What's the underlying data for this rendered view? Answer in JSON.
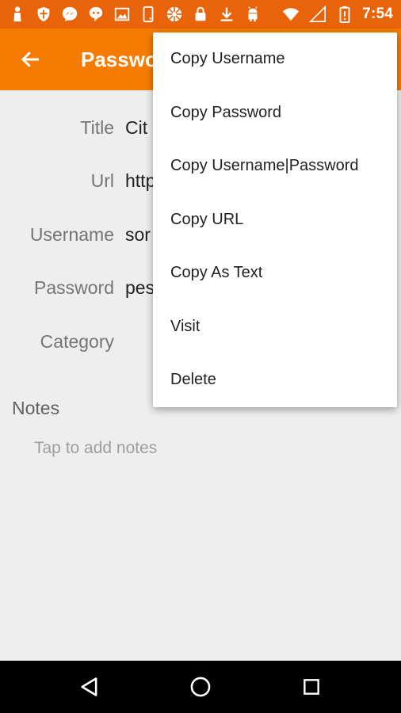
{
  "status_bar": {
    "time": "7:54",
    "icons_left": [
      "person-icon",
      "shield-icon",
      "messenger-icon",
      "chat-icon",
      "image-icon",
      "phone-icon",
      "settings-wheel-icon",
      "lock-icon",
      "download-icon",
      "android-icon"
    ],
    "icons_right": [
      "wifi-icon",
      "signal-icon",
      "battery-icon"
    ]
  },
  "app_bar": {
    "title": "Password",
    "back_icon": "arrow-back-icon",
    "color": "#f57c00"
  },
  "details": {
    "fields": [
      {
        "label": "Title",
        "value": "Cit"
      },
      {
        "label": "Url",
        "value": "http"
      },
      {
        "label": "Username",
        "value": "sor"
      },
      {
        "label": "Password",
        "value": "pes"
      },
      {
        "label": "Category",
        "value": ""
      }
    ],
    "notes_heading": "Notes",
    "notes_placeholder": "Tap to add notes"
  },
  "menu": {
    "items": [
      {
        "label": "Copy Username"
      },
      {
        "label": "Copy Password"
      },
      {
        "label": "Copy Username|Password"
      },
      {
        "label": "Copy URL"
      },
      {
        "label": "Copy As Text"
      },
      {
        "label": "Visit"
      },
      {
        "label": "Delete"
      }
    ]
  },
  "nav_bar": {
    "buttons": [
      "back-triangle-icon",
      "home-circle-icon",
      "recents-square-icon"
    ]
  }
}
